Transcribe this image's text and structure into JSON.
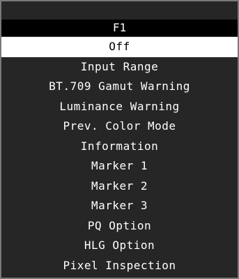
{
  "menu": {
    "title": "F1",
    "selected_index": 0,
    "items": [
      "Off",
      "Input Range",
      "BT.709 Gamut Warning",
      "Luminance Warning",
      "Prev. Color Mode",
      "Information",
      "Marker 1",
      "Marker 2",
      "Marker 3",
      "PQ Option",
      "HLG Option",
      "Pixel Inspection"
    ]
  },
  "colors": {
    "panel_background": "#262626",
    "header_background": "#000000",
    "selected_background": "#ffffff",
    "text": "#ffffff",
    "selected_text": "#000000",
    "border": "#7a7a7a"
  }
}
